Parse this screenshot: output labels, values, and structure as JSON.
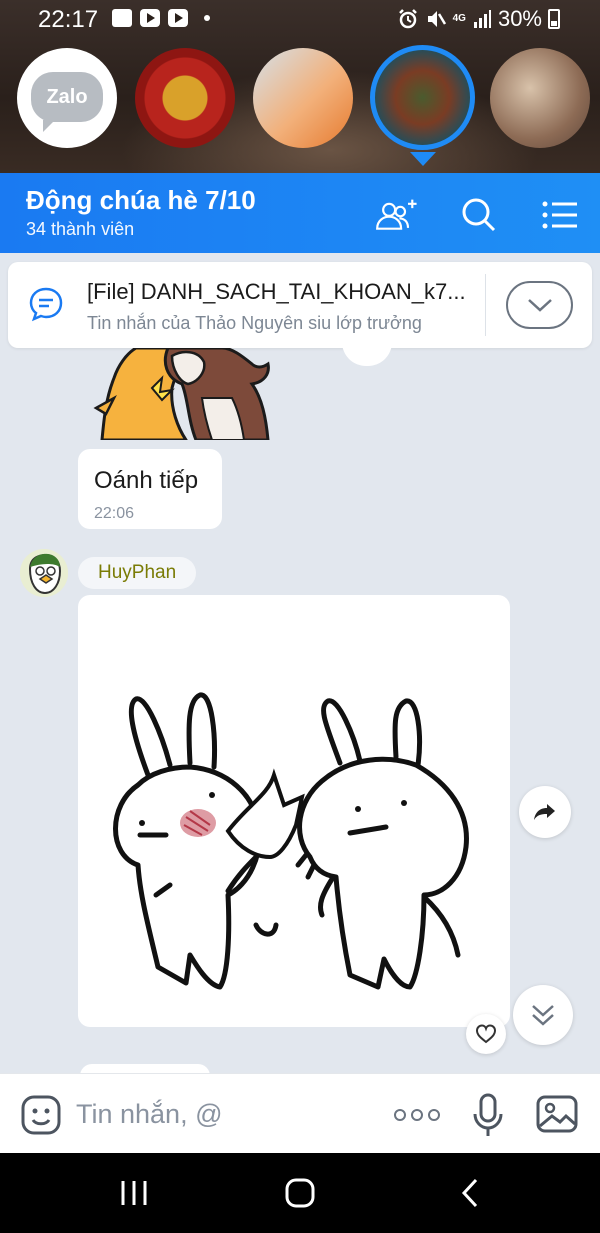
{
  "status_bar": {
    "time": "22:17",
    "network_badge": "4G",
    "battery": "30%"
  },
  "story_bubbles": [
    {
      "name": "zalo",
      "label": "Zalo"
    },
    {
      "name": "soviet-emblem"
    },
    {
      "name": "drinks"
    },
    {
      "name": "colorful-collage",
      "selected": true
    },
    {
      "name": "soldiers-illustration"
    }
  ],
  "header": {
    "title": "Động chúa hè 7/10",
    "subtitle": "34 thành viên"
  },
  "pinned": {
    "title": "[File] DANH_SACH_TAI_KHOAN_k7...",
    "subtitle": "Tin nhắn của Thảo Nguyên siu lớp trưởng"
  },
  "messages": [
    {
      "type": "text",
      "text": "Oánh tiếp",
      "time": "22:06"
    },
    {
      "type": "sticker",
      "sender": "HuyPhan"
    }
  ],
  "input": {
    "placeholder": "Tin nhắn, @"
  },
  "colors": {
    "header_blue": "#1a7af2",
    "sender_name": "#7a7c06",
    "chat_bg": "#e2e7ee"
  }
}
